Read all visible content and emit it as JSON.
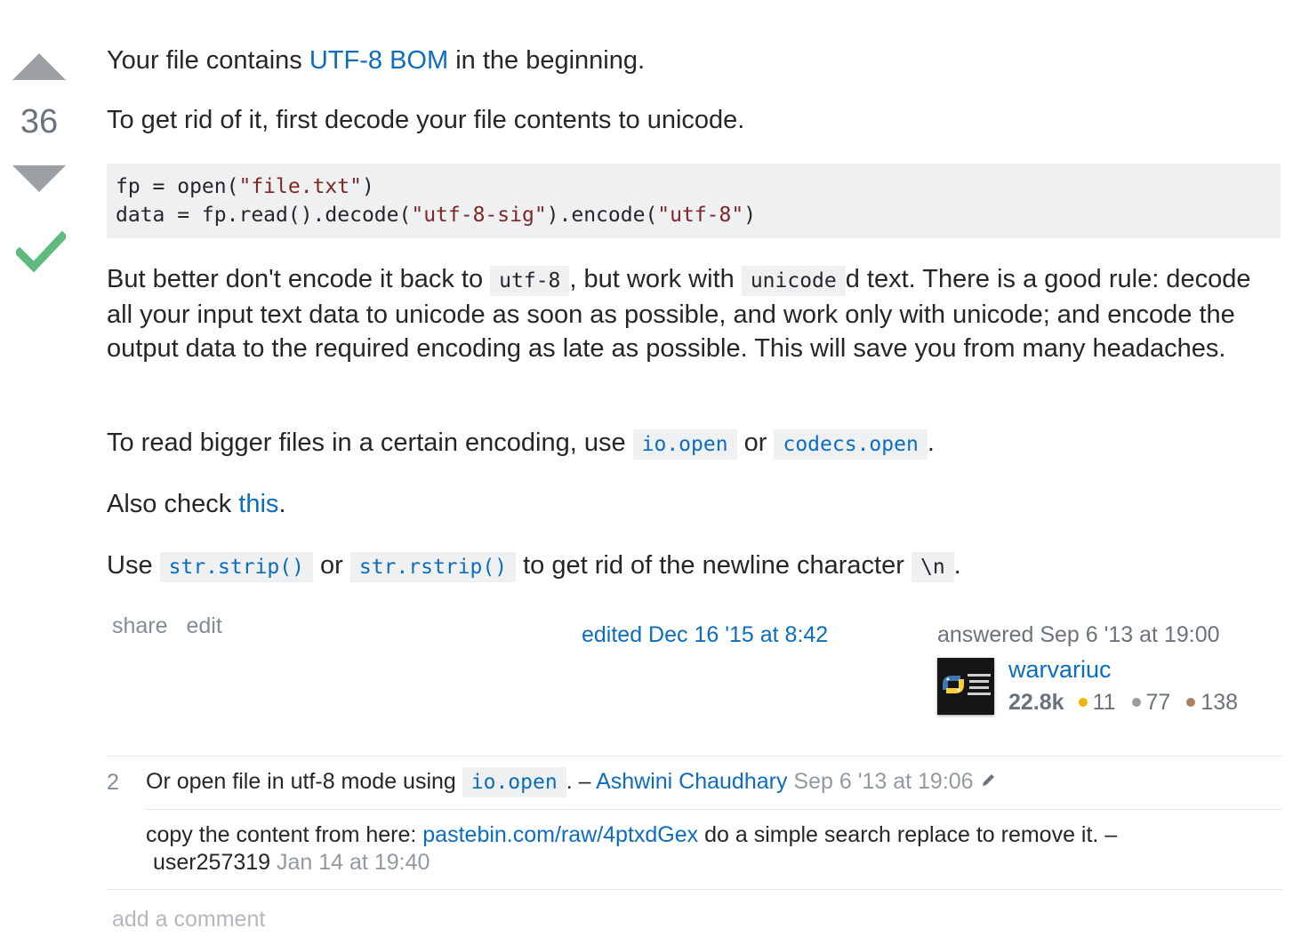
{
  "vote": {
    "count": "36",
    "up_icon": "arrow-up-icon",
    "down_icon": "arrow-down-icon",
    "accepted_icon": "checkmark-icon",
    "accepted_color": "#5fba7d"
  },
  "post": {
    "p1_pre": "Your file contains ",
    "p1_link": "UTF-8 BOM",
    "p1_post": " in the beginning.",
    "p2": "To get rid of it, first decode your file contents to unicode.",
    "code": {
      "l1_a": "fp = open(",
      "l1_s": "\"file.txt\"",
      "l1_b": ")",
      "l2_a": "data = fp.read().decode(",
      "l2_s1": "\"utf-8-sig\"",
      "l2_b": ").encode(",
      "l2_s2": "\"utf-8\"",
      "l2_c": ")"
    },
    "p3_a": "But better don't encode it back to ",
    "p3_code1": "utf-8",
    "p3_b": ", but work with ",
    "p3_code2": "unicode",
    "p3_c": "d text. There is a good rule: decode all your input text data to unicode as soon as possible, and work only with unicode; and encode the output data to the required encoding as late as possible. This will save you from many headaches.",
    "p4_a": "To read bigger files in a certain encoding, use ",
    "p4_code1": "io.open",
    "p4_b": " or ",
    "p4_code2": "codecs.open",
    "p4_c": ".",
    "p5_a": "Also check ",
    "p5_link": "this",
    "p5_b": ".",
    "p6_a": "Use ",
    "p6_code1": "str.strip()",
    "p6_b": " or ",
    "p6_code2": "str.rstrip()",
    "p6_c": " to get rid of the newline character ",
    "p6_code3": "\\n",
    "p6_d": "."
  },
  "meta": {
    "share": "share",
    "edit": "edit",
    "edited": "edited Dec 16 '15 at 8:42",
    "answered": "answered Sep 6 '13 at 19:00",
    "user": "warvariuc",
    "rep": "22.8k",
    "gold": "11",
    "silver": "77",
    "bronze": "138",
    "gold_color": "#f1b600",
    "silver_color": "#9a9c9f",
    "bronze_color": "#ab825f"
  },
  "comments": [
    {
      "score": "2",
      "text_a": "Or open file in utf-8 mode using ",
      "code": "io.open",
      "text_b": ". – ",
      "user": "Ashwini Chaudhary",
      "date": "Sep 6 '13 at 19:06",
      "edit_icon": "pencil-icon"
    },
    {
      "text_a": "copy the content from here: ",
      "link": "pastebin.com/raw/4ptxdGex",
      "text_b": " do a simple search replace to remove it. –",
      "user": "user257319",
      "date": "Jan 14 at 19:40"
    }
  ],
  "add_comment": "add a comment"
}
